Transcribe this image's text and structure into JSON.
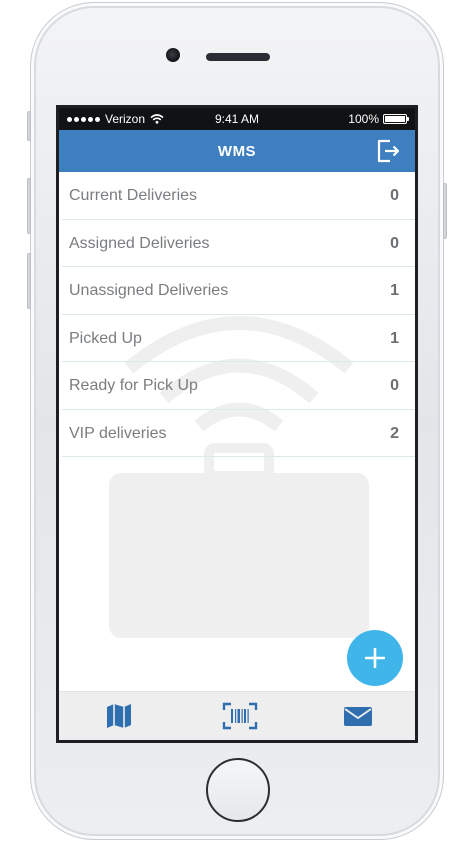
{
  "status_bar": {
    "carrier": "Verizon",
    "time": "9:41 AM",
    "battery": "100%"
  },
  "nav": {
    "title": "WMS",
    "right_icon": "logout-icon"
  },
  "deliveries": [
    {
      "label": "Current Deliveries",
      "count": "0"
    },
    {
      "label": "Assigned Deliveries",
      "count": "0"
    },
    {
      "label": "Unassigned Deliveries",
      "count": "1"
    },
    {
      "label": "Picked Up",
      "count": "1"
    },
    {
      "label": "Ready for Pick Up",
      "count": "0"
    },
    {
      "label": "VIP deliveries",
      "count": "2"
    }
  ],
  "fab_icon": "plus-icon",
  "tabs": [
    {
      "icon": "map-icon"
    },
    {
      "icon": "barcode-scan-icon"
    },
    {
      "icon": "mail-icon"
    }
  ],
  "colors": {
    "nav_bar": "#3d7fbf",
    "fab": "#3fb5ea",
    "tab_icon": "#2f6fb0",
    "tab_bar": "#eeeeee"
  }
}
